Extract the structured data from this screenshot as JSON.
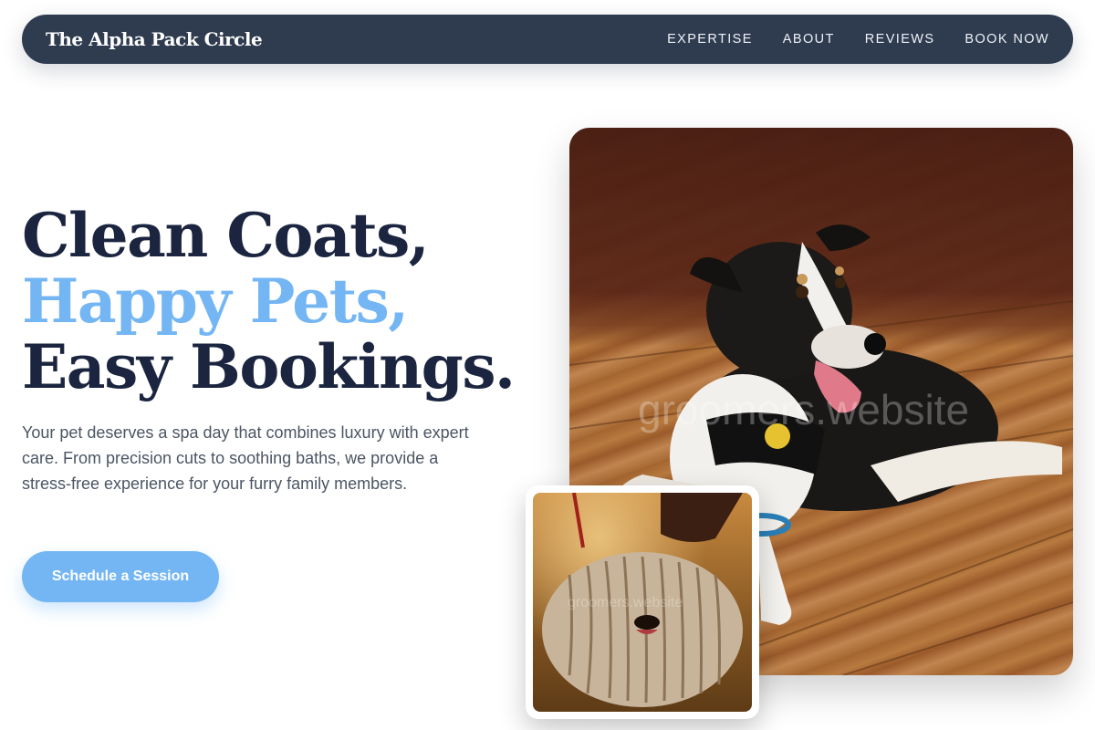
{
  "nav": {
    "brand": "The Alpha Pack Circle",
    "links": [
      {
        "label": "EXPERTISE"
      },
      {
        "label": "ABOUT"
      },
      {
        "label": "REVIEWS"
      },
      {
        "label": "BOOK NOW"
      }
    ]
  },
  "hero": {
    "title_line1": "Clean Coats,",
    "title_line2": "Happy Pets,",
    "title_line3": "Easy Bookings.",
    "description": "Your pet deserves a spa day that combines luxury with expert care. From precision cuts to soothing baths, we provide a stress-free experience for your furry family members.",
    "cta_label": "Schedule a Session",
    "accent_color": "#74b6f4"
  },
  "images": {
    "main_watermark": "groomers.website",
    "secondary_watermark": "groomers.website"
  }
}
